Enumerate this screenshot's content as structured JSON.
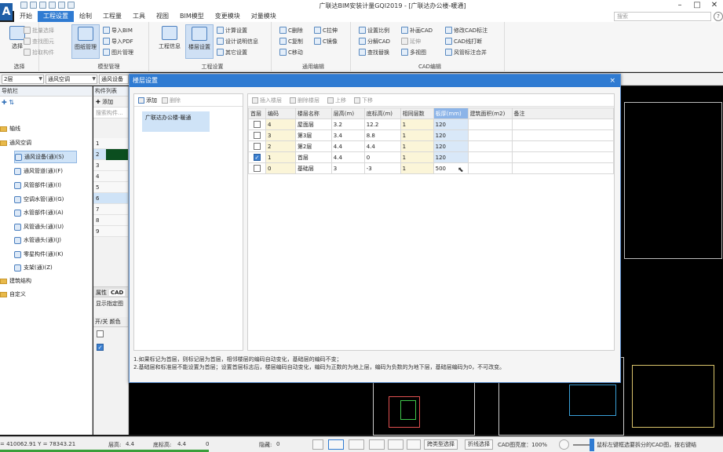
{
  "app": {
    "title": "广联达BIM安装计量GQI2019 - [广联达办公楼-暖通]",
    "logo": "A",
    "search_placeholder": "搜索",
    "help": "?"
  },
  "menu": {
    "tabs": [
      "开始",
      "工程设置",
      "绘制",
      "工程量",
      "工具",
      "视图",
      "BIM模型",
      "变更模块",
      "对量模块"
    ],
    "active": "工程设置"
  },
  "ribbon": {
    "groups": [
      {
        "label": "选择",
        "buttons": [
          {
            "label": "选择",
            "big": true
          },
          {
            "label": "批量选择"
          },
          {
            "label": "查找图元"
          },
          {
            "label": "拾取构件"
          }
        ]
      },
      {
        "label": "模型管理",
        "buttons": [
          {
            "label": "图纸管理",
            "big": true
          },
          {
            "label": "导入BIM"
          },
          {
            "label": "导入PDF"
          },
          {
            "label": "图片管理"
          }
        ]
      },
      {
        "label": "工程设置",
        "buttons": [
          {
            "label": "工程信息",
            "big": true
          },
          {
            "label": "楼层设置",
            "big": true
          },
          {
            "label": "计算设置"
          },
          {
            "label": "设计说明信息"
          },
          {
            "label": "其它设置"
          }
        ]
      },
      {
        "label": "通用编辑",
        "buttons": [
          {
            "label": "C删除"
          },
          {
            "label": "C复制"
          },
          {
            "label": "C移动"
          },
          {
            "label": "C拉伸"
          },
          {
            "label": "C镜像"
          }
        ]
      },
      {
        "label": "CAD编辑",
        "buttons": [
          {
            "label": "设置比例"
          },
          {
            "label": "分解CAD"
          },
          {
            "label": "查找替换"
          },
          {
            "label": "补画CAD"
          },
          {
            "label": "延伸"
          },
          {
            "label": "多视图"
          },
          {
            "label": "修改CAD标注"
          },
          {
            "label": "CAD线打断"
          },
          {
            "label": "风管标注合并"
          }
        ]
      }
    ]
  },
  "combobar": {
    "floor": "2层",
    "discipline": "通风空调",
    "component": "通风设备"
  },
  "nav": {
    "header": "导航栏",
    "items": [
      {
        "label": "轴线",
        "type": "folder"
      },
      {
        "label": "通风空调",
        "type": "folder"
      },
      {
        "label": "通风设备(通)(S)",
        "type": "item",
        "selected": true
      },
      {
        "label": "通风管道(通)(F)",
        "type": "item"
      },
      {
        "label": "风管部件(通)(I)",
        "type": "item"
      },
      {
        "label": "空调水管(通)(G)",
        "type": "item"
      },
      {
        "label": "水管部件(通)(A)",
        "type": "item"
      },
      {
        "label": "风管通头(通)(U)",
        "type": "item"
      },
      {
        "label": "水管通头(通)(J)",
        "type": "item"
      },
      {
        "label": "零星构件(通)(K)",
        "type": "item"
      },
      {
        "label": "支架(通)(Z)",
        "type": "item"
      },
      {
        "label": "建筑结构",
        "type": "folder"
      },
      {
        "label": "自定义",
        "type": "folder"
      }
    ]
  },
  "complist": {
    "header": "构件列表",
    "add": "添加",
    "search_placeholder": "搜索构件...",
    "rows": [
      "1",
      "2",
      "3",
      "4",
      "5",
      "6",
      "7",
      "8",
      "9"
    ],
    "props_tab": "属性",
    "cad_tab": "CAD",
    "show_label": "显示指定图",
    "col1": "开/关",
    "col2": "颜色"
  },
  "dialog": {
    "title": "楼层设置",
    "close": "×",
    "left_toolbar": {
      "add": "添加",
      "delete": "删除"
    },
    "project": "广联达办公楼-暖通",
    "right_toolbar": {
      "insert": "插入楼层",
      "delete": "删除楼层",
      "up": "上移",
      "down": "下移"
    },
    "columns": [
      "首层",
      "编码",
      "楼层名称",
      "层高(m)",
      "底标高(m)",
      "相同层数",
      "板厚(mm)",
      "建筑面积(m2)",
      "备注"
    ],
    "rows": [
      {
        "first": false,
        "code": "4",
        "name": "屋面层",
        "height": "3.2",
        "bottom": "12.2",
        "same": "1",
        "slab": "120",
        "area": "",
        "note": ""
      },
      {
        "first": false,
        "code": "3",
        "name": "第3层",
        "height": "3.4",
        "bottom": "8.8",
        "same": "1",
        "slab": "120",
        "area": "",
        "note": ""
      },
      {
        "first": false,
        "code": "2",
        "name": "第2层",
        "height": "4.4",
        "bottom": "4.4",
        "same": "1",
        "slab": "120",
        "area": "",
        "note": ""
      },
      {
        "first": true,
        "code": "1",
        "name": "首层",
        "height": "4.4",
        "bottom": "0",
        "same": "1",
        "slab": "120",
        "area": "",
        "note": ""
      },
      {
        "first": false,
        "code": "0",
        "name": "基础层",
        "height": "3",
        "bottom": "-3",
        "same": "1",
        "slab": "500",
        "area": "",
        "note": ""
      }
    ],
    "notes": [
      "1.如果标记为首层，则标记层为首层，相邻楼层的编码自动变化，基础层的编码不变；",
      "2.基础层和标准层不能设置为首层；设置首层标志后，楼层编码自动变化，编码为正数的为地上层，编码为负数的为地下层，基础层编码为0，不可改变。"
    ]
  },
  "status": {
    "coords": "= 410062.91 Y = 78343.21",
    "layer_height_label": "层高:",
    "layer_height": "4.4",
    "bottom_label": "底标高:",
    "bottom": "4.4",
    "zero": "0",
    "hidden_label": "隐藏:",
    "hidden": "0",
    "cross_select": "跨类型选择",
    "line_select": "折线选择",
    "cad_brightness": "CAD图亮度：100%",
    "tip": "鼠标左键框选要拆分的CAD图，按右键结"
  }
}
